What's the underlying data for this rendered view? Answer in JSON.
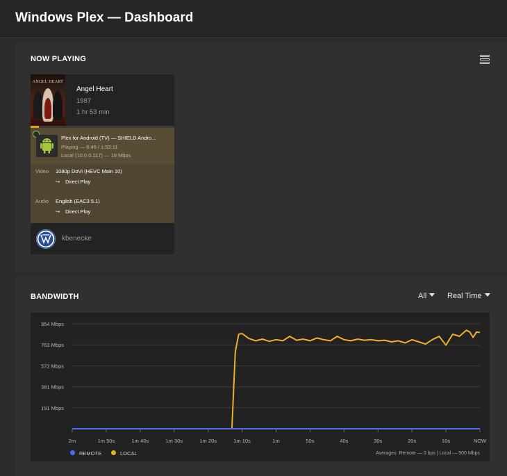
{
  "app": {
    "title": "Windows Plex — Dashboard"
  },
  "now_playing": {
    "section_title": "NOW PLAYING",
    "menu_icon": "list-view-icon",
    "session": {
      "poster_text": "ANGEL HEART",
      "title": "Angel Heart",
      "year": "1987",
      "duration": "1 hr 53 min",
      "progress": 0.06,
      "player": "Plex for Android (TV)  —  SHIELD Andro...",
      "state": "Playing — 6:46 / 1:53:11",
      "network": "Local (10.0.0.117) — 19 Mbps",
      "video_label": "Video",
      "video_value": "1080p DoVi (HEVC Main 10)",
      "video_decision": "Direct Play",
      "audio_label": "Audio",
      "audio_value": "English (EAC3 5.1)",
      "audio_decision": "Direct Play",
      "user": "kbenecke",
      "accent": "#e5a00d"
    }
  },
  "bandwidth": {
    "section_title": "BANDWIDTH",
    "filter_selected": "All",
    "range_selected": "Real Time",
    "legend_remote": "REMOTE",
    "legend_local": "LOCAL",
    "remote_color": "#4a6cf7",
    "local_color": "#f0b02a",
    "averages": "Averages: Remote — 0 bps | Local — 500 Mbps"
  },
  "chart_data": {
    "type": "line",
    "x_tick_labels": [
      "2m",
      "1m 50s",
      "1m 40s",
      "1m 30s",
      "1m 20s",
      "1m 10s",
      "1m",
      "50s",
      "40s",
      "30s",
      "20s",
      "10s",
      "NOW"
    ],
    "y_tick_labels": [
      "954 Mbps",
      "763 Mbps",
      "572 Mbps",
      "381 Mbps",
      "191 Mbps"
    ],
    "ylim": [
      0,
      954
    ],
    "xlim": [
      -120,
      0
    ],
    "x_unit": "seconds relative to now",
    "y_unit": "Mbps",
    "series": [
      {
        "name": "LOCAL",
        "color": "#f0b02a",
        "x": [
          -120,
          -115,
          -110,
          -105,
          -100,
          -95,
          -90,
          -85,
          -80,
          -75,
          -73,
          -72,
          -71,
          -70,
          -68,
          -66,
          -64,
          -62,
          -60,
          -58,
          -56,
          -54,
          -52,
          -50,
          -48,
          -46,
          -44,
          -42,
          -40,
          -38,
          -36,
          -34,
          -32,
          -30,
          -28,
          -26,
          -24,
          -22,
          -20,
          -18,
          -16,
          -14,
          -12,
          -10,
          -8,
          -6,
          -4,
          -3,
          -2,
          -1,
          0
        ],
        "y": [
          0,
          0,
          0,
          0,
          0,
          0,
          0,
          0,
          0,
          0,
          0,
          700,
          860,
          865,
          820,
          800,
          815,
          795,
          810,
          800,
          840,
          805,
          815,
          800,
          825,
          810,
          800,
          840,
          810,
          800,
          815,
          805,
          810,
          800,
          805,
          790,
          800,
          780,
          810,
          790,
          770,
          810,
          840,
          760,
          860,
          840,
          895,
          880,
          830,
          880,
          875
        ]
      },
      {
        "name": "REMOTE",
        "color": "#4a6cf7",
        "x": [
          -120,
          0
        ],
        "y": [
          0,
          0
        ]
      }
    ],
    "grid": true,
    "legend_position": "bottom-left"
  }
}
